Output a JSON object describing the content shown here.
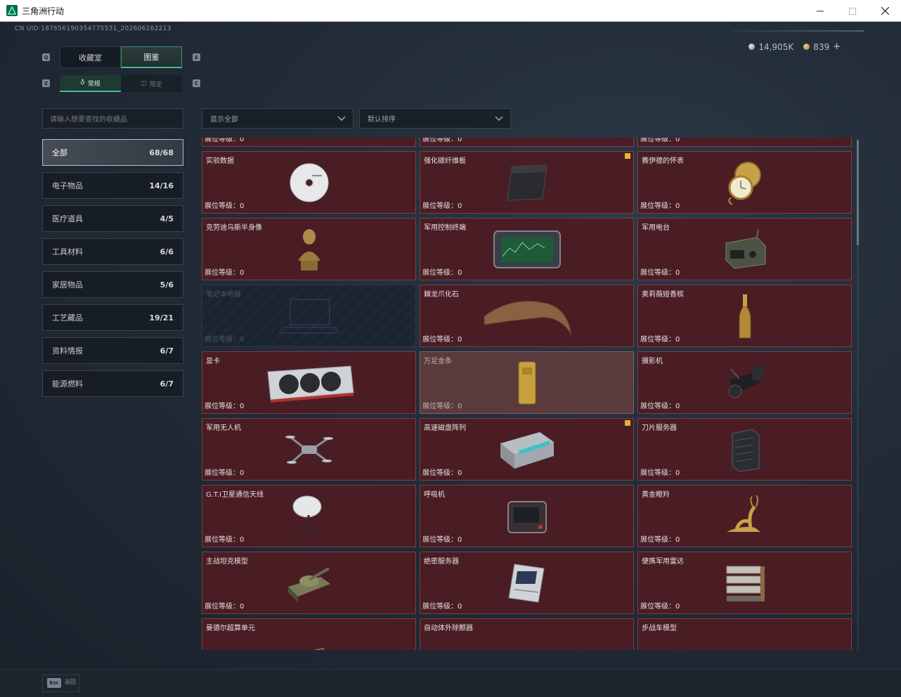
{
  "window": {
    "title": "三角洲行动"
  },
  "uid": "CN UID:18765619035477553‌1_202606162213",
  "currency": {
    "silver": "14,905K",
    "gold": "839",
    "add": "+"
  },
  "hotkeys": {
    "q": "Q",
    "e": "E",
    "z": "Z",
    "c": "C"
  },
  "tabs": [
    {
      "label": "收藏室"
    },
    {
      "label": "图鉴"
    }
  ],
  "subtabs": [
    {
      "label": "常规"
    },
    {
      "label": "限定"
    }
  ],
  "search": {
    "placeholder": "请输入想要查找的收藏品"
  },
  "filters": {
    "show": "显示全部",
    "sort": "默认排序"
  },
  "categories": [
    {
      "name": "全部",
      "count": "68/68"
    },
    {
      "name": "电子物品",
      "count": "14/16"
    },
    {
      "name": "医疗道具",
      "count": "4/5"
    },
    {
      "name": "工具材料",
      "count": "6/6"
    },
    {
      "name": "家居物品",
      "count": "5/6"
    },
    {
      "name": "工艺藏品",
      "count": "19/21"
    },
    {
      "name": "资料情报",
      "count": "6/7"
    },
    {
      "name": "能源燃料",
      "count": "6/7"
    }
  ],
  "level_label": "展位等级：0",
  "items": [
    {
      "name": "实验数据"
    },
    {
      "name": "强化碳纤维板"
    },
    {
      "name": "赛伊德的怀表"
    },
    {
      "name": "克劳迪乌斯半身像"
    },
    {
      "name": "军用控制终端"
    },
    {
      "name": "军用电台"
    },
    {
      "name": "笔记本电脑"
    },
    {
      "name": "棘龙爪化石"
    },
    {
      "name": "奥莉薇娅香槟"
    },
    {
      "name": "显卡"
    },
    {
      "name": "万足金条"
    },
    {
      "name": "摄影机"
    },
    {
      "name": "军用无人机"
    },
    {
      "name": "高速磁盘阵列"
    },
    {
      "name": "刀片服务器"
    },
    {
      "name": "G.T.I卫星通信天线"
    },
    {
      "name": "呼吸机"
    },
    {
      "name": "黄金瞪羚"
    },
    {
      "name": "主战坦克模型"
    },
    {
      "name": "绝密服务器"
    },
    {
      "name": "便携军用雷达"
    },
    {
      "name": "曼德尔超算单元"
    },
    {
      "name": "自动体外除颤器"
    },
    {
      "name": "步战车模型"
    }
  ],
  "footer": {
    "esc_key": "Esc",
    "esc_label": "返回"
  }
}
